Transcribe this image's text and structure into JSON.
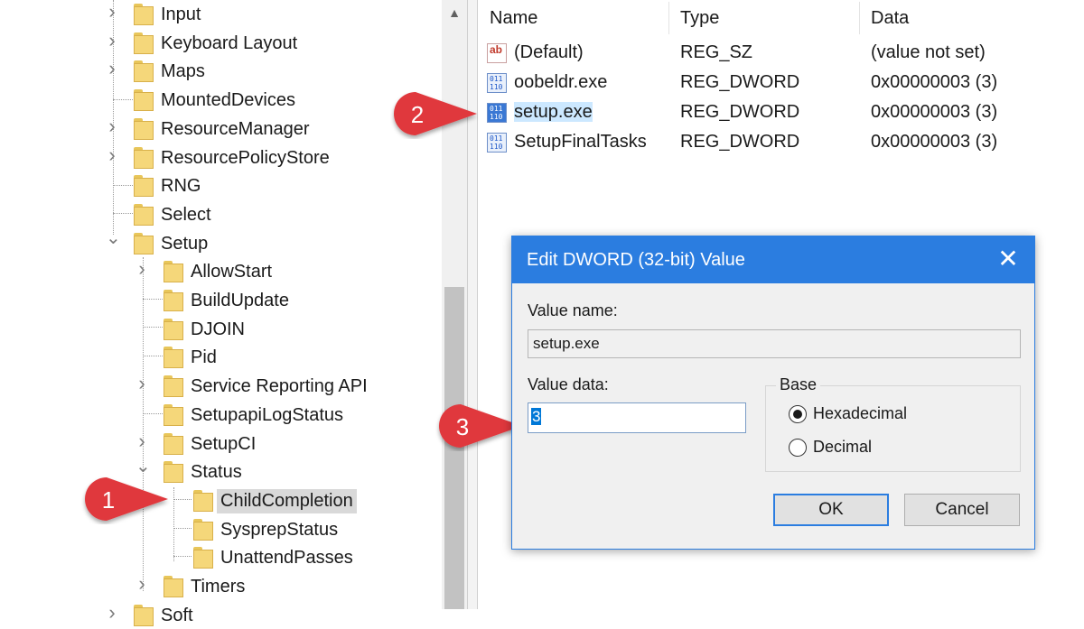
{
  "tree": {
    "items": [
      {
        "label": "Input",
        "expander": ">"
      },
      {
        "label": "Keyboard Layout",
        "expander": ">"
      },
      {
        "label": "Maps",
        "expander": ">"
      },
      {
        "label": "MountedDevices",
        "expander": ""
      },
      {
        "label": "ResourceManager",
        "expander": ">"
      },
      {
        "label": "ResourcePolicyStore",
        "expander": ">"
      },
      {
        "label": "RNG",
        "expander": ""
      },
      {
        "label": "Select",
        "expander": ""
      },
      {
        "label": "Setup",
        "expander": "v"
      },
      {
        "label": "AllowStart",
        "expander": ">"
      },
      {
        "label": "BuildUpdate",
        "expander": ""
      },
      {
        "label": "DJOIN",
        "expander": ""
      },
      {
        "label": "Pid",
        "expander": ""
      },
      {
        "label": "Service Reporting API",
        "expander": ">"
      },
      {
        "label": "SetupapiLogStatus",
        "expander": ""
      },
      {
        "label": "SetupCI",
        "expander": ">"
      },
      {
        "label": "Status",
        "expander": "v"
      },
      {
        "label": "ChildCompletion",
        "expander": ""
      },
      {
        "label": "SysprepStatus",
        "expander": ""
      },
      {
        "label": "UnattendPasses",
        "expander": ""
      },
      {
        "label": "Timers",
        "expander": ">"
      },
      {
        "label": "Soft",
        "expander": ">"
      }
    ]
  },
  "list": {
    "columns": [
      "Name",
      "Type",
      "Data"
    ],
    "rows": [
      {
        "icon": "string-value-icon",
        "icon_text": "ab",
        "name": "(Default)",
        "type": "REG_SZ",
        "data": "(value not set)"
      },
      {
        "icon": "dword-value-icon",
        "icon_text": "011\n110",
        "name": "oobeldr.exe",
        "type": "REG_DWORD",
        "data": "0x00000003 (3)"
      },
      {
        "icon": "dword-value-icon",
        "icon_text": "011\n110",
        "name": "setup.exe",
        "type": "REG_DWORD",
        "data": "0x00000003 (3)"
      },
      {
        "icon": "dword-value-icon",
        "icon_text": "011\n110",
        "name": "SetupFinalTasks",
        "type": "REG_DWORD",
        "data": "0x00000003 (3)"
      }
    ]
  },
  "callouts": [
    "1",
    "2",
    "3"
  ],
  "dialog": {
    "title": "Edit DWORD (32-bit) Value",
    "close_glyph": "✕",
    "value_name_label": "Value name:",
    "value_name": "setup.exe",
    "value_data_label": "Value data:",
    "value_data": "3",
    "base_label": "Base",
    "base_options": [
      "Hexadecimal",
      "Decimal"
    ],
    "base_selected": "Hexadecimal",
    "ok_label": "OK",
    "cancel_label": "Cancel"
  },
  "colors": {
    "accent": "#2b7de0",
    "callout_red": "#e0393e",
    "folder": "#f5d77a",
    "selection": "#d9d9d9"
  }
}
